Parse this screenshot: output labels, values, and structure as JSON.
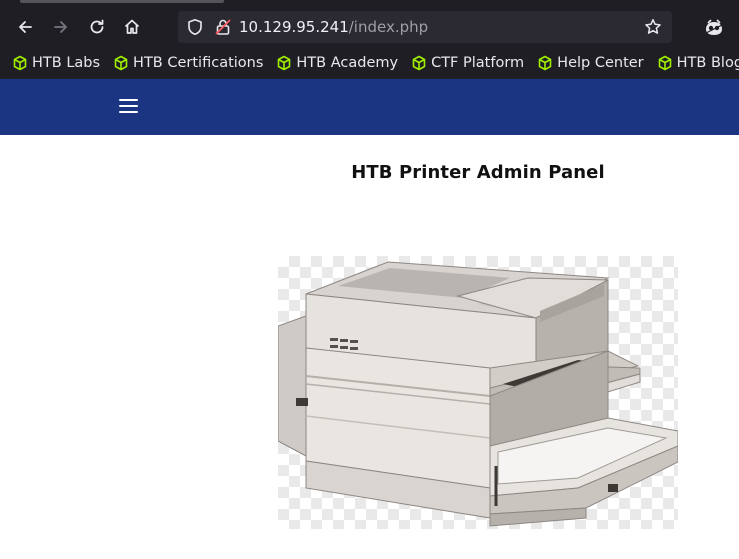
{
  "browser": {
    "url_host": "10.129.95.241",
    "url_path": "/index.php",
    "bookmarks": [
      {
        "label": "HTB Labs"
      },
      {
        "label": "HTB Certifications"
      },
      {
        "label": "HTB Academy"
      },
      {
        "label": "CTF Platform"
      },
      {
        "label": "Help Center"
      },
      {
        "label": "HTB Blog"
      }
    ],
    "bookmark_icon_color": "#9fef00"
  },
  "page": {
    "header_color": "#1b3582",
    "title": "HTB Printer Admin Panel"
  }
}
